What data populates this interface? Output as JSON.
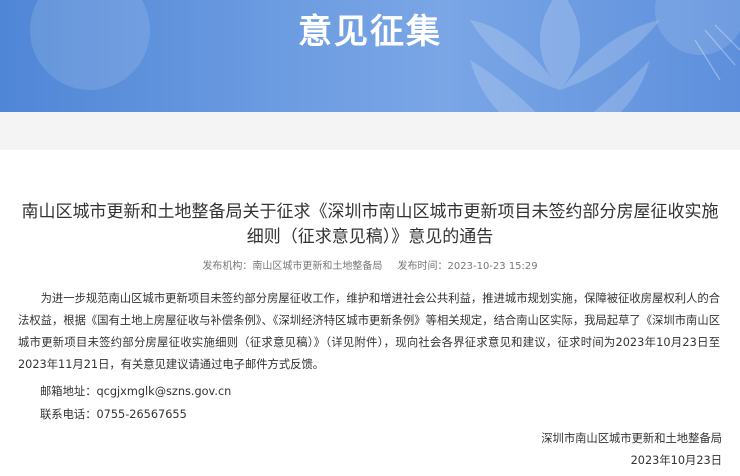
{
  "banner": {
    "title": "意见征集"
  },
  "article": {
    "title_line1": "南山区城市更新和土地整备局关于征求《深圳市南山区城市更新项目未签约部分房屋征收实施",
    "title_line2": "细则（征求意见稿）》意见的通告",
    "meta": {
      "publisher": "发布机构：南山区城市更新和土地整备局",
      "time": "发布时间：2023-10-23 15:29"
    },
    "body": "为进一步规范南山区城市更新项目未签约部分房屋征收工作，维护和增进社会公共利益，推进城市规划实施，保障被征收房屋权利人的合法权益，根据《国有土地上房屋征收与补偿条例》、《深圳经济特区城市更新条例》等相关规定，结合南山区实际，我局起草了《深圳市南山区城市更新项目未签约部分房屋征收实施细则（征求意见稿）》（详见附件），现向社会各界征求意见和建议，征求时间为2023年10月23日至2023年11月21日，有关意见建议请通过电子邮件方式反馈。",
    "email": "邮箱地址：qcgjxmglk@szns.gov.cn",
    "phone": "联系电话：0755-26567655",
    "signature": "深圳市南山区城市更新和土地整备局",
    "date": "2023年10月23日"
  }
}
